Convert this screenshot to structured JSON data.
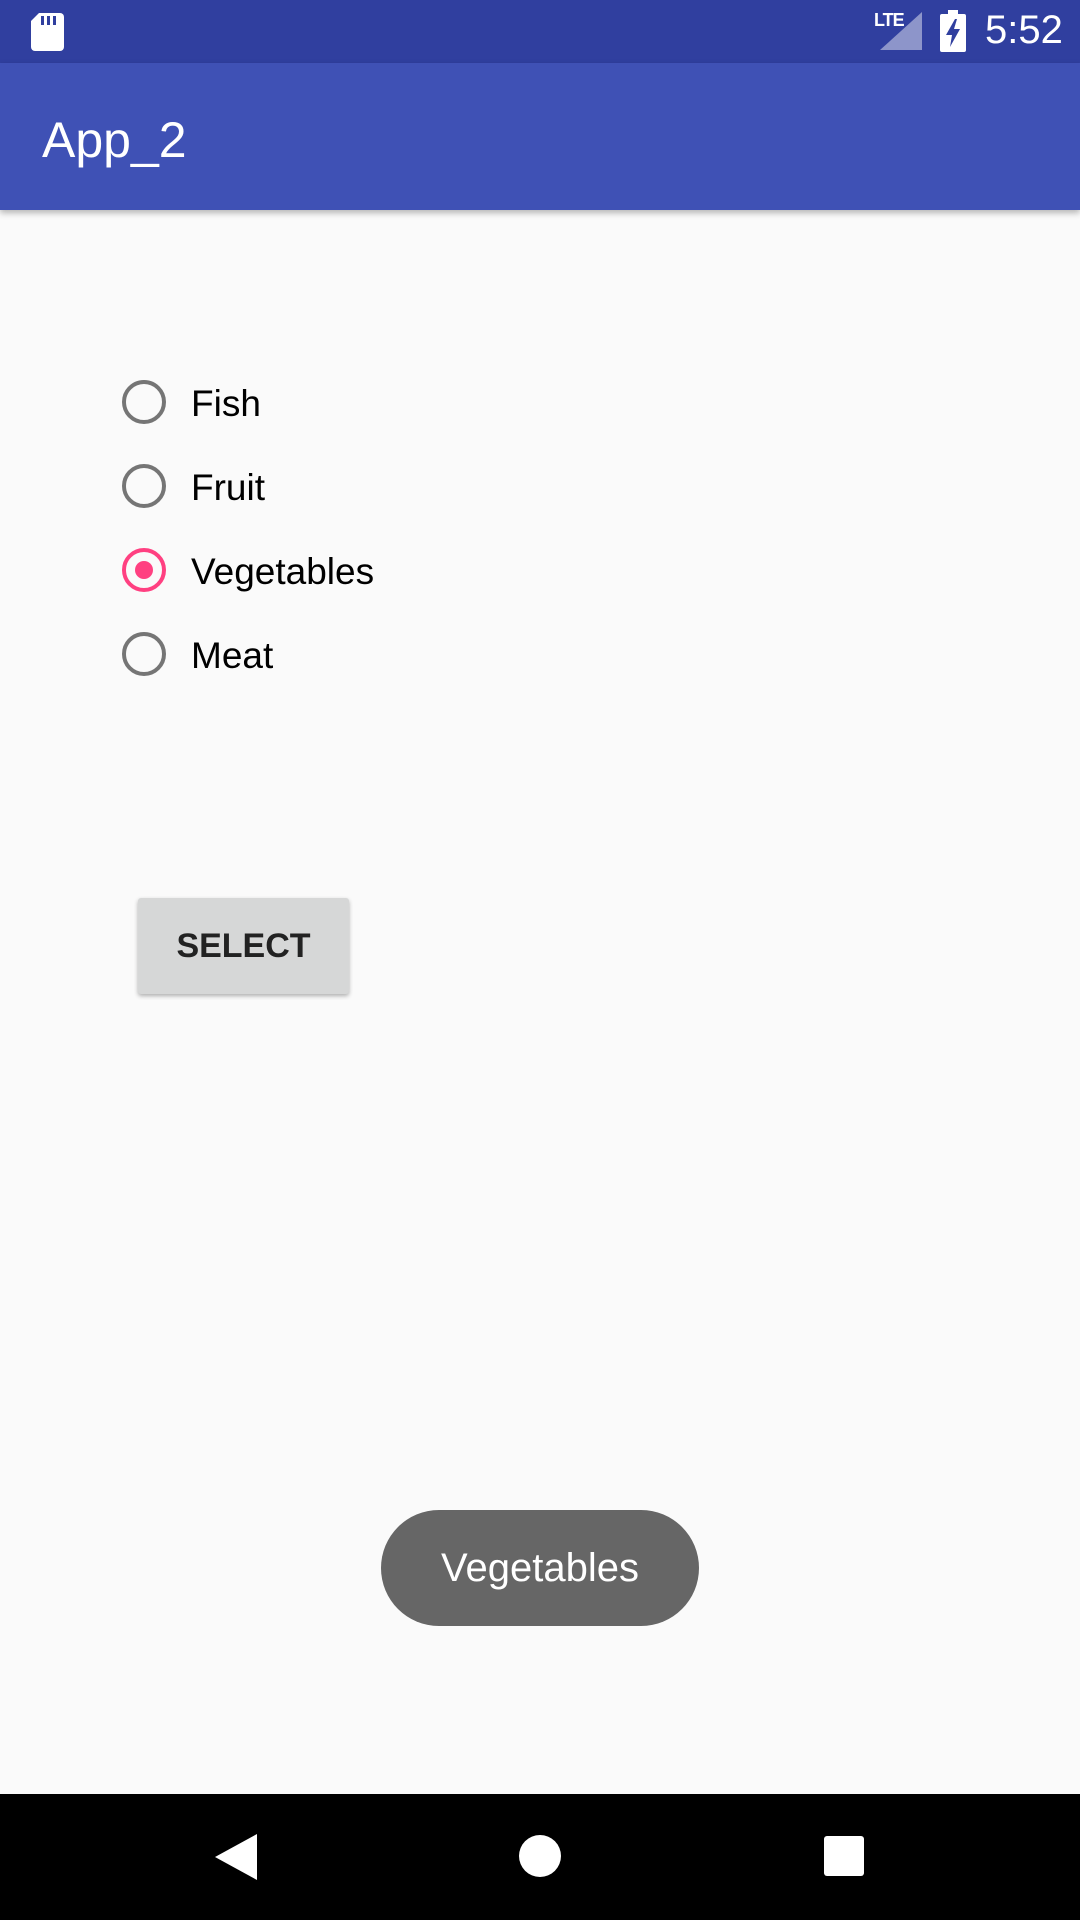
{
  "status_bar": {
    "network_type": "LTE",
    "time": "5:52",
    "icons": [
      "sd-card-icon",
      "signal-icon",
      "battery-charging-icon"
    ]
  },
  "app_bar": {
    "title": "App_2"
  },
  "radio_group": {
    "options": [
      {
        "label": "Fish",
        "checked": false
      },
      {
        "label": "Fruit",
        "checked": false
      },
      {
        "label": "Vegetables",
        "checked": true
      },
      {
        "label": "Meat",
        "checked": false
      }
    ]
  },
  "select_button": {
    "label": "SELECT"
  },
  "toast": {
    "text": "Vegetables"
  },
  "nav_bar": {
    "icons": [
      "back-icon",
      "home-icon",
      "recents-icon"
    ]
  },
  "colors": {
    "status_bar": "#303f9f",
    "app_bar": "#3f51b5",
    "accent": "#ff4081",
    "background": "#fafafa",
    "button": "#d6d7d7",
    "toast": "#666666"
  }
}
